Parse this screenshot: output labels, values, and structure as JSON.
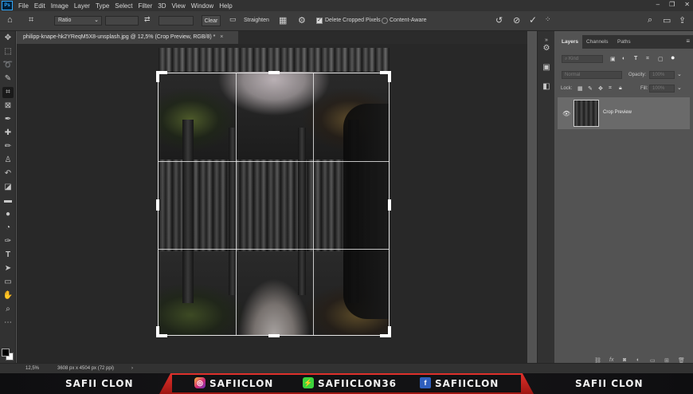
{
  "app": {
    "logo": "Ps"
  },
  "menu": [
    "File",
    "Edit",
    "Image",
    "Layer",
    "Type",
    "Select",
    "Filter",
    "3D",
    "View",
    "Window",
    "Help"
  ],
  "window_controls": [
    "–",
    "❐",
    "✕"
  ],
  "options_bar": {
    "ratio_label": "Ratio",
    "clear_label": "Clear",
    "straighten_label": "Straighten",
    "delete_cropped_label": "Delete Cropped Pixels",
    "delete_cropped_checked": true,
    "content_aware_label": "Content-Aware",
    "content_aware_checked": false,
    "commit_icon": "✓",
    "cancel_icon": "⊘",
    "reset_icon": "↺"
  },
  "document": {
    "tab_title": "philipp-knape-hk2YReqM5X8-unsplash.jpg @ 12,5% (Crop Preview, RGB/8) *",
    "close_glyph": "×"
  },
  "toolbar_icons": [
    "move-icon",
    "marquee-icon",
    "lasso-icon",
    "quick-select-icon",
    "crop-icon",
    "frame-icon",
    "eyedropper-icon",
    "healing-icon",
    "brush-icon",
    "stamp-icon",
    "history-brush-icon",
    "eraser-icon",
    "gradient-icon",
    "blur-icon",
    "dodge-icon",
    "pen-icon",
    "type-icon",
    "path-select-icon",
    "rectangle-icon",
    "hand-icon",
    "zoom-icon",
    "more-icon"
  ],
  "layers_panel": {
    "tabs": [
      "Layers",
      "Channels",
      "Paths"
    ],
    "active_tab": "Layers",
    "filter_placeholder": "Kind",
    "blend_mode": "Normal",
    "opacity_label": "Opacity:",
    "opacity_value": "100%",
    "lock_label": "Lock:",
    "fill_label": "Fill:",
    "fill_value": "100%",
    "layers": [
      {
        "name": "Crop Preview",
        "visible": true
      }
    ],
    "footer_icons": [
      "link-icon",
      "fx-icon",
      "mask-icon",
      "adjustment-icon",
      "group-icon",
      "new-layer-icon",
      "trash-icon"
    ]
  },
  "status": {
    "zoom": "12,5%",
    "doc_info": "3608 px x 4504 px (72 ppi)"
  },
  "banner": {
    "left_name": "SAFII CLON",
    "instagram_handle": "SAFIICLON",
    "game_handle": "SAFIICLON36",
    "facebook_handle": "SAFIICLON",
    "right_name": "SAFII CLON",
    "accent_color": "#e0312c"
  },
  "colors": {
    "accent": "#31a8ff",
    "panel_bg": "#535353",
    "canvas_bg": "#282828"
  }
}
